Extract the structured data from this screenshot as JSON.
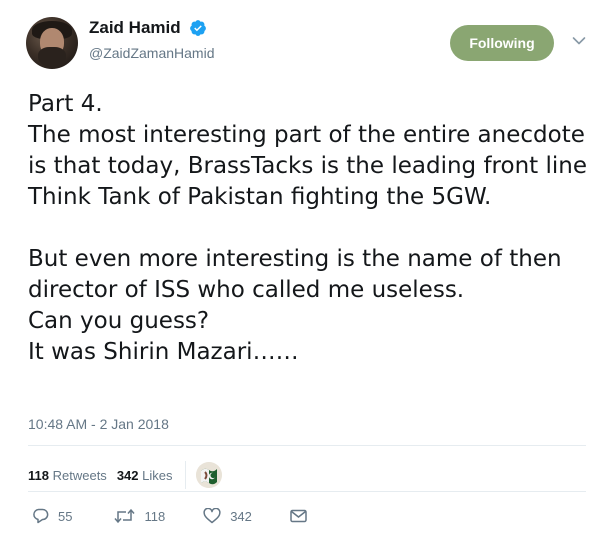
{
  "user": {
    "display_name": "Zaid Hamid",
    "handle": "@ZaidZamanHamid",
    "verified": true
  },
  "follow_button": {
    "label": "Following",
    "color": "#8aa672"
  },
  "tweet": {
    "text": "Part 4.\nThe most interesting part of the entire anecdote is that today, BrassTacks is the leading front line Think Tank of Pakistan fighting the 5GW.\n\nBut even more interesting is the name of then director of ISS who called me useless.\nCan you guess?\nIt was Shirin Mazari……",
    "timestamp": "10:48 AM - 2 Jan 2018"
  },
  "stats": {
    "retweets_count": "118",
    "retweets_label": "Retweets",
    "likes_count": "342",
    "likes_label": "Likes"
  },
  "actions": {
    "reply_count": "55",
    "retweet_count": "118",
    "like_count": "342"
  },
  "colors": {
    "text": "#14171a",
    "secondary": "#657786",
    "verified": "#1da1f2",
    "divider": "#e6ecf0"
  },
  "icons": {
    "verified": "verified-badge-icon",
    "menu": "chevron-down-icon",
    "reply": "reply-icon",
    "retweet": "retweet-icon",
    "like": "heart-icon",
    "message": "envelope-icon"
  }
}
